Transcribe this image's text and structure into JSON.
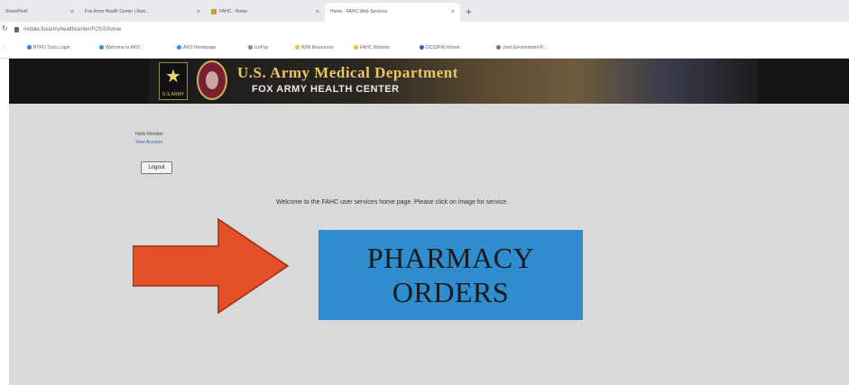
{
  "browser": {
    "tabs": [
      {
        "label": "SharePoint"
      },
      {
        "label": "Fox Army Health Center | Red..."
      },
      {
        "label": "FAHC - Home"
      },
      {
        "label": "Home - FAHC Web Services"
      }
    ],
    "url": "mobile.foxarmyhealthcenter/FOSS/home",
    "bookmarks": [
      {
        "label": "BTRO Tools Login",
        "color": "#4a7fd4"
      },
      {
        "label": "Welcome to AKO",
        "color": "#3f8fd8"
      },
      {
        "label": "AKO Homepage",
        "color": "#3f8fd8"
      },
      {
        "label": "IcePay",
        "color": "#888888"
      },
      {
        "label": "WMI Resources",
        "color": "#e8c13a"
      },
      {
        "label": "FAHC Website",
        "color": "#e8c13a"
      },
      {
        "label": "DCSDHA Infonet",
        "color": "#3f59c9"
      },
      {
        "label": "Joint Environment R...",
        "color": "#777777"
      }
    ]
  },
  "header": {
    "title": "U.S. Army Medical Department",
    "subtitle": "FOX ARMY HEALTH CENTER",
    "army_logo_text": "U.S.ARMY"
  },
  "user": {
    "greeting": "Hello Member",
    "view_account": "View Account",
    "logout_label": "Logout"
  },
  "main": {
    "welcome_text": "Welcome to the FAHC user services home page. Please click on image for service.",
    "service_button": {
      "line1": "PHARMACY",
      "line2": "ORDERS",
      "color": "#2e8ccf"
    },
    "arrow_color": "#e4502a"
  }
}
